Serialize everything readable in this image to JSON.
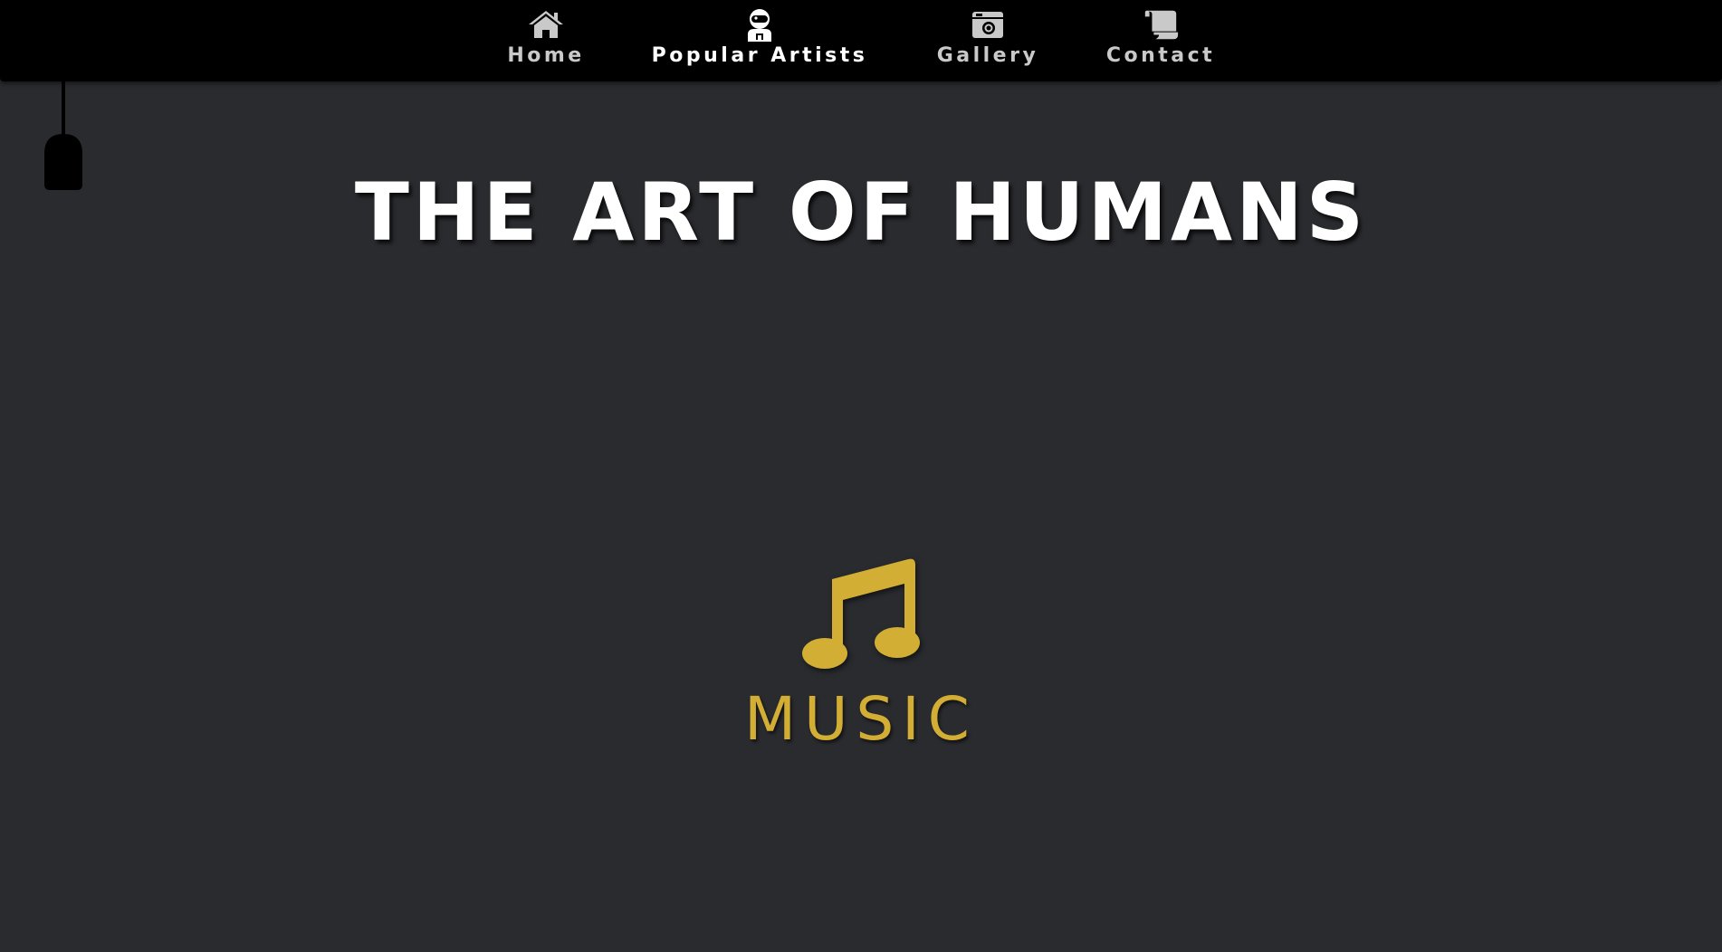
{
  "nav": {
    "items": [
      {
        "label": "Home",
        "icon": "home-icon",
        "active": false
      },
      {
        "label": "Popular Artists",
        "icon": "astronaut-icon",
        "active": true
      },
      {
        "label": "Gallery",
        "icon": "camera-icon",
        "active": false
      },
      {
        "label": "Contact",
        "icon": "scroll-icon",
        "active": false
      }
    ]
  },
  "hero": {
    "title": "THE ART OF HUMANS"
  },
  "category": {
    "label": "MUSIC",
    "icon": "music-note-icon"
  },
  "colors": {
    "background": "#2a2b2f",
    "navbar": "#000000",
    "nav_text": "#c9c9c9",
    "nav_text_active": "#ffffff",
    "accent": "#d3ae35"
  }
}
